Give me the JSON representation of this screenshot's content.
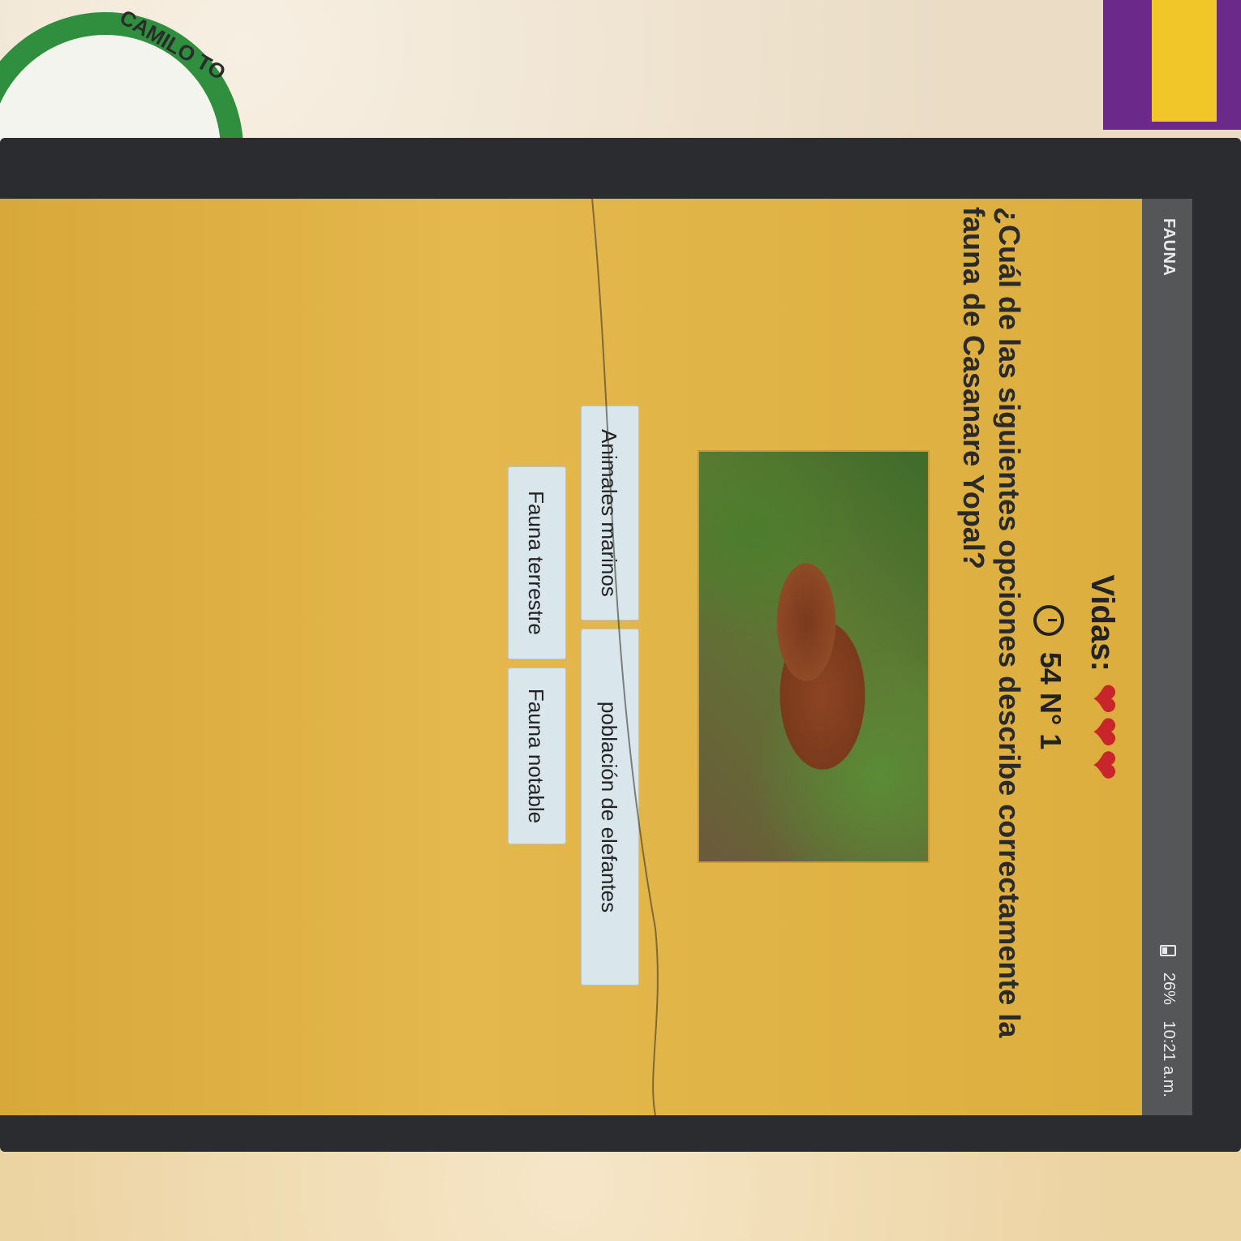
{
  "app": {
    "section_title": "FAUNA"
  },
  "status_bar": {
    "battery": "26%",
    "time": "10:21 a.m."
  },
  "game": {
    "lives_label": "Vidas:",
    "lives_count": 3,
    "timer_value": "54",
    "question_number": "N° 1",
    "question": "¿Cuál de las siguientes opciones describe correctamente la fauna de Casanare Yopal?",
    "options": [
      "Animales marinos",
      "población de elefantes",
      "Fauna terrestre",
      "Fauna notable"
    ]
  },
  "background": {
    "badge_text": "CAMILO TO"
  },
  "colors": {
    "app_background": "#dcb042",
    "status_bar": "#545658",
    "heart": "#c9252c",
    "option_button": "#d9e7ec"
  }
}
